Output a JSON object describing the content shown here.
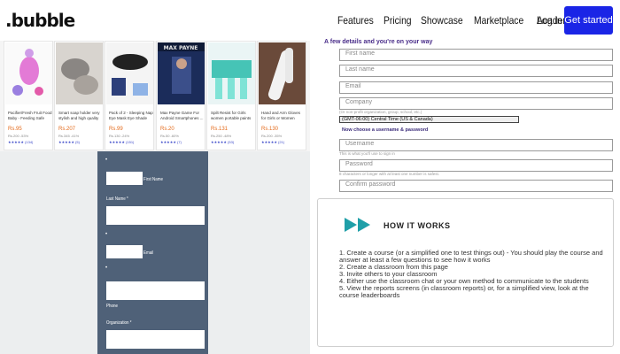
{
  "header": {
    "logo": ".bubble",
    "nav": [
      "Features",
      "Pricing",
      "Showcase",
      "Marketplace",
      "Academy"
    ],
    "login": "Log in",
    "cta": "Get started",
    "cta_color": "#1a25e6"
  },
  "products": [
    {
      "title": "Pacifier/Fresh Fruit Food Baby - Feeding Safe Fruit...",
      "price": "Rs.95",
      "discount": "Rs.200 -53%",
      "rating": "★★★★★ (134)"
    },
    {
      "title": "Smart soap holder very stylish and high quality hea...",
      "price": "Rs.207",
      "discount": "Rs.345 -41%",
      "rating": "★★★★★ (5)"
    },
    {
      "title": "Pack of 2 - Sleeping Nap Eye Mask Eye Shade Cove...",
      "price": "Rs.99",
      "discount": "Rs.130 -24%",
      "rating": "★★★★★ (151)"
    },
    {
      "title": "Max Payne Game For Android Smartphones ...",
      "price": "Rs.20",
      "discount": "Rs.50 -60%",
      "rating": "★★★★★ (7)"
    },
    {
      "title": "Spilt Resist for Girls women portable paints pack of 6",
      "price": "Rs.131",
      "discount": "Rs.250 -48%",
      "rating": "★★★★★ (53)"
    },
    {
      "title": "Hand and Arm Gloves for Girls or Women (Muslim...",
      "price": "Rs.130",
      "discount": "Rs.200 -35%",
      "rating": "★★★★★ (21)"
    }
  ],
  "left_form": {
    "first_name_label": "First Name",
    "last_name_label": "Last Name *",
    "email_label": "Email",
    "phone_label": "Phone",
    "organization_label": "Organization *"
  },
  "right_form": {
    "heading": "A few details and you're on your way",
    "first_name": "First name",
    "last_name": "Last name",
    "email": "Email",
    "company": "Company",
    "company_note": "(Or non-profit organization, group, school, etc.)",
    "timezone": "(GMT-06:00) Central Time (US & Canada)",
    "choose": "Now choose a username & password",
    "username": "Username",
    "username_note": "This is what you'll use to sign in",
    "password": "Password",
    "password_note": "8 characters or longer with at least one number is safest.",
    "confirm_password": "Confirm password"
  },
  "how_it_works": {
    "title": "HOW IT WORKS",
    "steps": [
      "1. Create a course (or a simplified one to test things out) - You should play the course and answer at least a few questions to see how it works",
      "2. Create a classroom from this page",
      "3. Invite others to your classroom",
      "4. Either use the classroom chat or your own method to communicate to the students",
      "5. View the reports screens (in classroom reports) or, for a simplified view, look at the course leaderboards"
    ]
  }
}
